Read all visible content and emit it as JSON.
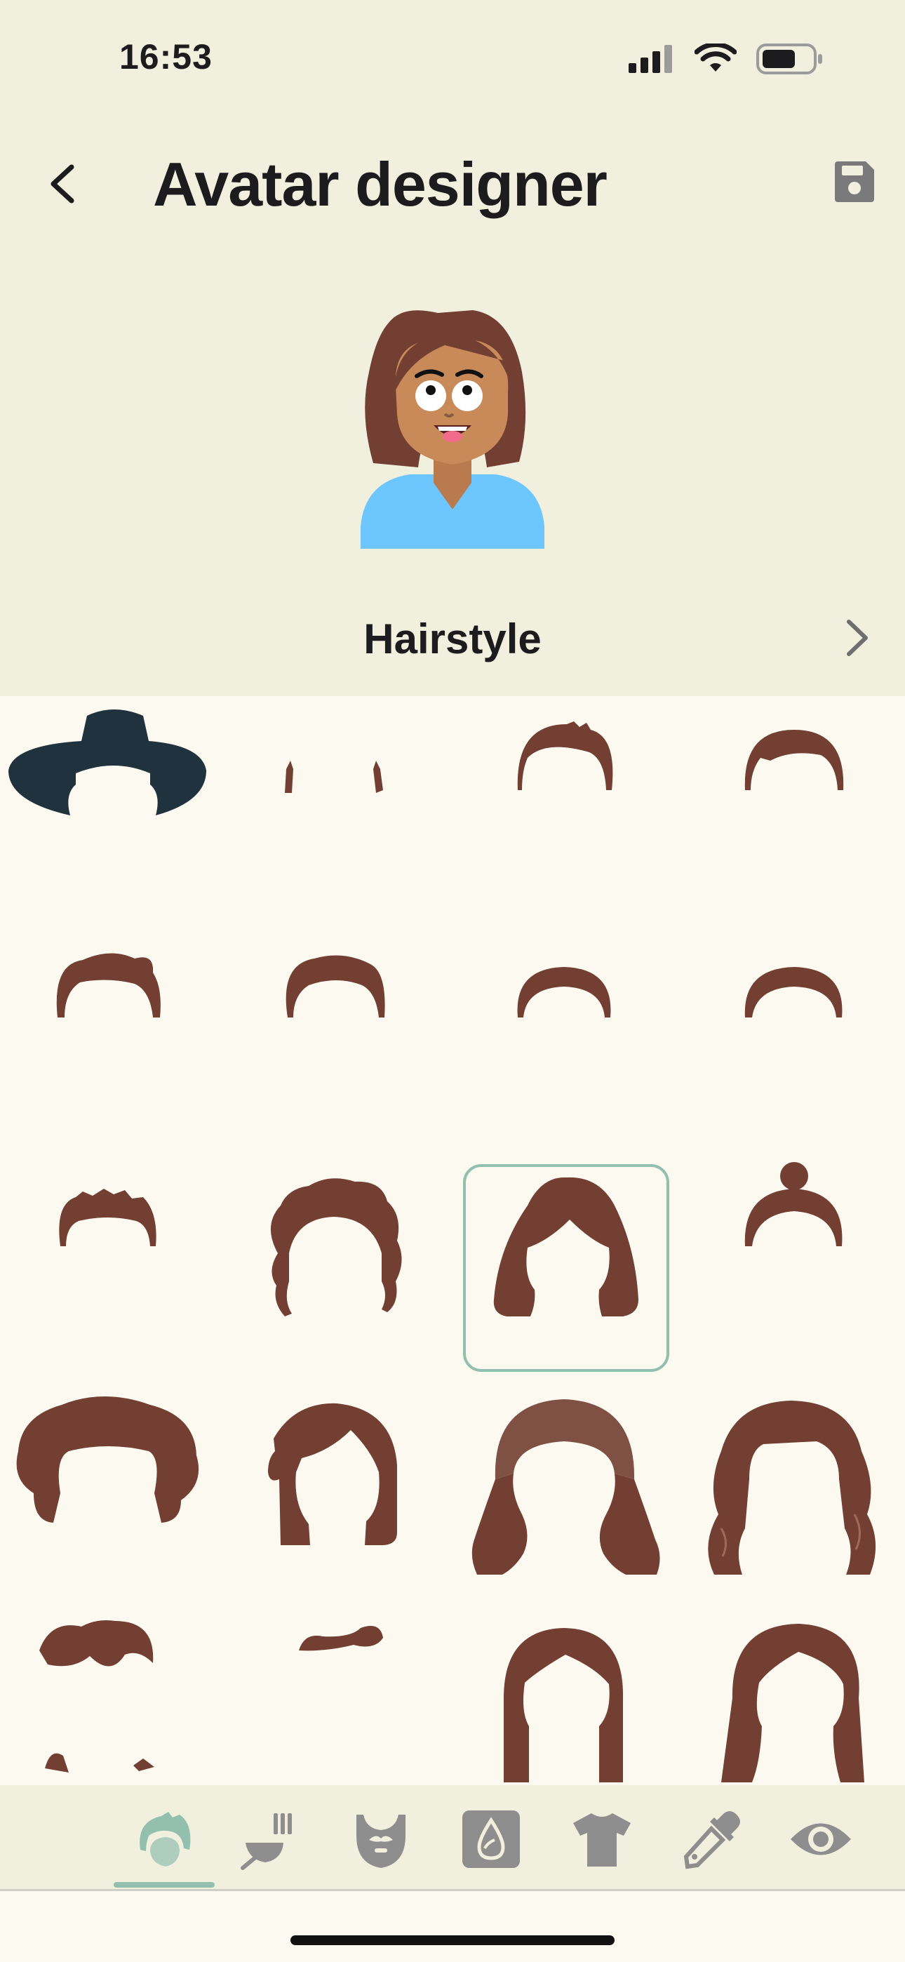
{
  "status_bar": {
    "time": "16:53"
  },
  "header": {
    "title": "Avatar designer"
  },
  "category": {
    "title": "Hairstyle"
  },
  "colors": {
    "header_bg": "#f1efde",
    "grid_bg": "#fcf9f0",
    "hair": "#733f33",
    "hat": "#1f323e",
    "skin": "#c98a5a",
    "shirt": "#6ec6ff",
    "accent": "#93bfae",
    "icon_gray": "#8e8e8e"
  },
  "hairstyles": [
    {
      "icon": "hat-icon"
    },
    {
      "icon": "hair-sideburns-icon"
    },
    {
      "icon": "hair-short-spiky-icon"
    },
    {
      "icon": "hair-short-side-part-icon"
    },
    {
      "icon": "hair-quiff-icon"
    },
    {
      "icon": "hair-pompadour-icon"
    },
    {
      "icon": "hair-buzz-icon"
    },
    {
      "icon": "hair-crew-icon"
    },
    {
      "icon": "hair-cropped-icon"
    },
    {
      "icon": "hair-curly-short-icon"
    },
    {
      "icon": "hair-bob-icon",
      "selected": true
    },
    {
      "icon": "hair-bun-icon"
    },
    {
      "icon": "hair-afro-icon"
    },
    {
      "icon": "hair-side-bob-icon"
    },
    {
      "icon": "hair-long-wavy-icon"
    },
    {
      "icon": "hair-long-curly-icon"
    },
    {
      "icon": "hair-swept-icon"
    },
    {
      "icon": "hair-flick-icon"
    },
    {
      "icon": "hair-long-straight-icon"
    },
    {
      "icon": "hair-long-part-icon"
    }
  ],
  "tabs": [
    {
      "icon": "hair-tab-icon",
      "active": true
    },
    {
      "icon": "hair-color-tab-icon"
    },
    {
      "icon": "beard-tab-icon"
    },
    {
      "icon": "skin-tone-tab-icon"
    },
    {
      "icon": "shirt-tab-icon"
    },
    {
      "icon": "color-picker-tab-icon"
    },
    {
      "icon": "eye-tab-icon"
    }
  ]
}
